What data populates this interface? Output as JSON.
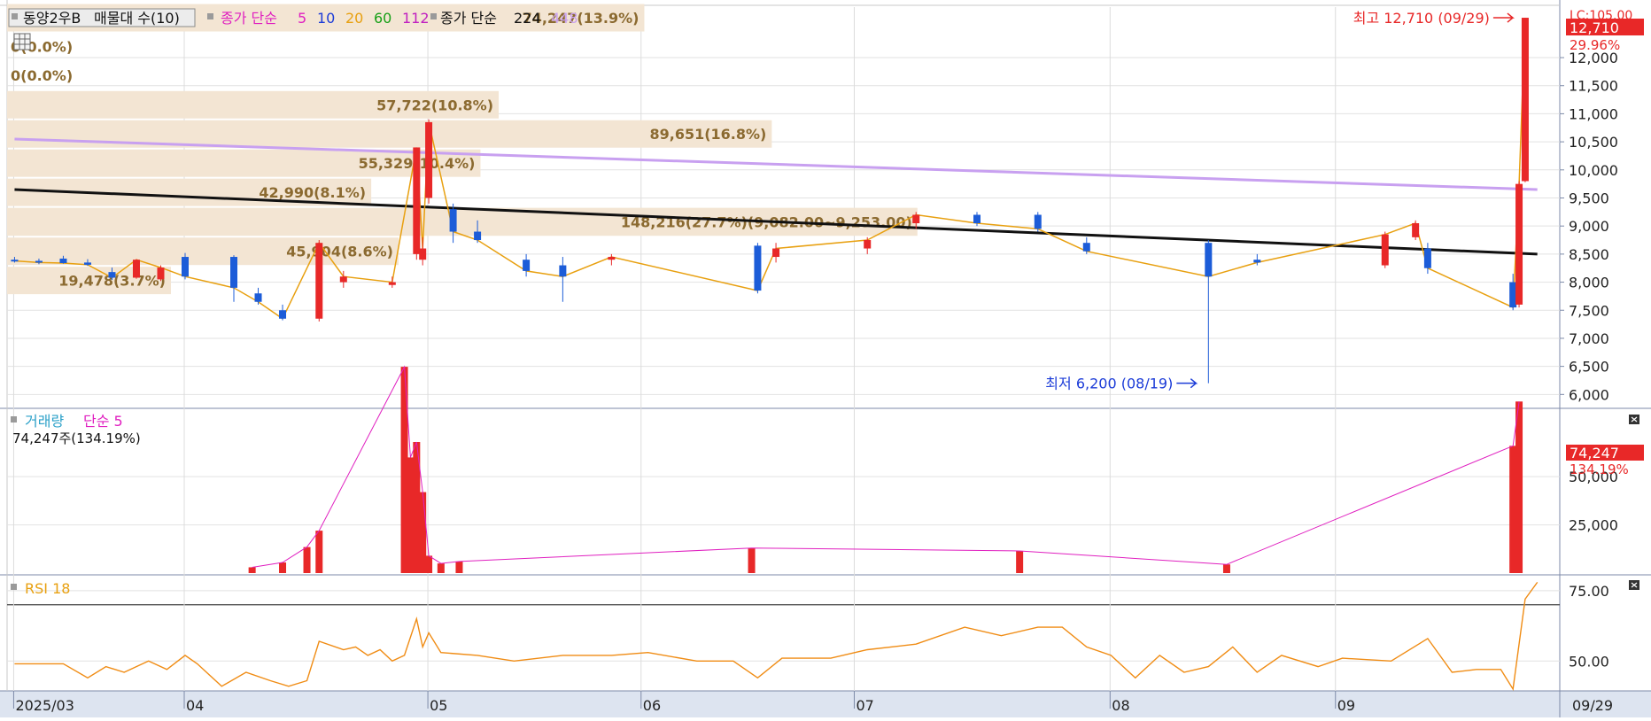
{
  "header": {
    "title": "동양2우B",
    "vp_label": "매물대 수(10)",
    "ma_prefix": "종가 단순",
    "ma_periods": [
      "5",
      "10",
      "20",
      "60",
      "112"
    ],
    "ma_colors": [
      "#e020c0",
      "#1c3cd8",
      "#e8a010",
      "#18a018",
      "#c020c0"
    ],
    "ma2_prefix": "종가 단순",
    "ma2_periods": [
      "224",
      "448"
    ],
    "ma2_colors": [
      "#111111",
      "#c8a0f0"
    ]
  },
  "price_panel": {
    "ylim": [
      5800,
      12900
    ],
    "ticks": [
      "12,000",
      "11,500",
      "11,000",
      "10,500",
      "10,000",
      "9,500",
      "9,000",
      "8,500",
      "8,000",
      "7,500",
      "7,000",
      "6,500",
      "6,000"
    ],
    "tick_values": [
      12000,
      11500,
      11000,
      10500,
      10000,
      9500,
      9000,
      8500,
      8000,
      7500,
      7000,
      6500,
      6000
    ],
    "last_price_label": "12,710",
    "last_change_label": "29.96%",
    "corner_label": "LC:105.00",
    "high_label": "최고 12,710 (09/29)",
    "low_label": "최저 6,200 (08/19)",
    "volume_profile": [
      {
        "label": "74,247(13.9%)",
        "low": 12450,
        "high": 12970,
        "width": 0.7
      },
      {
        "label": "0(0.0%)",
        "low": 11950,
        "high": 12450,
        "width": 0.0
      },
      {
        "label": "0(0.0%)",
        "low": 11420,
        "high": 11950,
        "width": 0.0
      },
      {
        "label": "57,722(10.8%)",
        "low": 10900,
        "high": 11420,
        "width": 0.54
      },
      {
        "label": "89,651(16.8%)",
        "low": 10380,
        "high": 10900,
        "width": 0.84
      },
      {
        "label": "55,329(10.4%)",
        "low": 9860,
        "high": 10380,
        "width": 0.52
      },
      {
        "label": "42,990(8.1%)",
        "low": 9340,
        "high": 9860,
        "width": 0.4
      },
      {
        "label": "148,216(27.7%)(9,082.00~9,253.00)",
        "low": 8810,
        "high": 9340,
        "width": 1.4
      },
      {
        "label": "45,904(8.6%)",
        "low": 8290,
        "high": 8810,
        "width": 0.43
      },
      {
        "label": "19,478(3.7%)",
        "low": 7770,
        "high": 8290,
        "width": 0.18
      }
    ]
  },
  "volume_panel": {
    "title": "거래량",
    "ma_label": "단순 5",
    "current_label": "74,247주(134.19%)",
    "ylim": [
      0,
      85000
    ],
    "ticks": [
      "50,000",
      "25,000"
    ],
    "tick_values": [
      50000,
      25000
    ],
    "last_volume_label": "74,247",
    "last_ratio_label": "134.19%"
  },
  "rsi_panel": {
    "title": "RSI 18",
    "ylim": [
      40,
      80
    ],
    "ticks": [
      "75.00",
      "50.00"
    ],
    "tick_values": [
      75,
      50
    ],
    "threshold": 70
  },
  "x_axis": {
    "labels": [
      "2025/03",
      "04",
      "05",
      "06",
      "07",
      "08",
      "09",
      "09/29"
    ],
    "label_index": [
      0,
      28,
      68,
      103,
      138,
      180,
      217,
      260
    ]
  },
  "chart_data": {
    "type": "candlestick",
    "title": "동양2우B",
    "n_days": 252,
    "price_high": {
      "value": 12710,
      "date": "09/29"
    },
    "price_low": {
      "value": 6200,
      "date": "08/19"
    },
    "ohlc": [
      {
        "i": 0,
        "o": 8400,
        "h": 8450,
        "l": 8350,
        "c": 8380
      },
      {
        "i": 4,
        "o": 8380,
        "h": 8420,
        "l": 8320,
        "c": 8350
      },
      {
        "i": 8,
        "o": 8420,
        "h": 8470,
        "l": 8330,
        "c": 8340
      },
      {
        "i": 12,
        "o": 8350,
        "h": 8410,
        "l": 8290,
        "c": 8310
      },
      {
        "i": 16,
        "o": 8180,
        "h": 8260,
        "l": 8040,
        "c": 8080
      },
      {
        "i": 20,
        "o": 8080,
        "h": 8410,
        "l": 8060,
        "c": 8400
      },
      {
        "i": 24,
        "o": 8050,
        "h": 8300,
        "l": 8020,
        "c": 8260
      },
      {
        "i": 28,
        "o": 8450,
        "h": 8520,
        "l": 8050,
        "c": 8100
      },
      {
        "i": 36,
        "o": 8450,
        "h": 8480,
        "l": 7650,
        "c": 7900
      },
      {
        "i": 40,
        "o": 7800,
        "h": 7900,
        "l": 7600,
        "c": 7650
      },
      {
        "i": 44,
        "o": 7500,
        "h": 7600,
        "l": 7320,
        "c": 7350
      },
      {
        "i": 50,
        "o": 7350,
        "h": 8750,
        "l": 7300,
        "c": 8700
      },
      {
        "i": 54,
        "o": 8000,
        "h": 8200,
        "l": 7900,
        "c": 8100
      },
      {
        "i": 62,
        "o": 7950,
        "h": 8100,
        "l": 7900,
        "c": 8000
      },
      {
        "i": 66,
        "o": 8500,
        "h": 10400,
        "l": 8400,
        "c": 10400
      },
      {
        "i": 67,
        "o": 8400,
        "h": 8800,
        "l": 8300,
        "c": 8600
      },
      {
        "i": 68,
        "o": 9500,
        "h": 10900,
        "l": 9400,
        "c": 10850
      },
      {
        "i": 72,
        "o": 9300,
        "h": 9400,
        "l": 8700,
        "c": 8900
      },
      {
        "i": 76,
        "o": 8900,
        "h": 9100,
        "l": 8700,
        "c": 8750
      },
      {
        "i": 84,
        "o": 8400,
        "h": 8500,
        "l": 8100,
        "c": 8200
      },
      {
        "i": 90,
        "o": 8300,
        "h": 8450,
        "l": 7650,
        "c": 8100
      },
      {
        "i": 98,
        "o": 8400,
        "h": 8500,
        "l": 8300,
        "c": 8450
      },
      {
        "i": 122,
        "o": 8650,
        "h": 8700,
        "l": 7800,
        "c": 7850
      },
      {
        "i": 125,
        "o": 8450,
        "h": 8700,
        "l": 8350,
        "c": 8600
      },
      {
        "i": 140,
        "o": 8600,
        "h": 8800,
        "l": 8500,
        "c": 8750
      },
      {
        "i": 148,
        "o": 9050,
        "h": 9250,
        "l": 8950,
        "c": 9200
      },
      {
        "i": 158,
        "o": 9200,
        "h": 9250,
        "l": 9000,
        "c": 9050
      },
      {
        "i": 168,
        "o": 9200,
        "h": 9250,
        "l": 8900,
        "c": 8950
      },
      {
        "i": 176,
        "o": 8700,
        "h": 8800,
        "l": 8500,
        "c": 8550
      },
      {
        "i": 196,
        "o": 8700,
        "h": 8750,
        "l": 6200,
        "c": 8100
      },
      {
        "i": 204,
        "o": 8400,
        "h": 8500,
        "l": 8300,
        "c": 8350
      },
      {
        "i": 225,
        "o": 8300,
        "h": 8900,
        "l": 8250,
        "c": 8850
      },
      {
        "i": 230,
        "o": 8800,
        "h": 9100,
        "l": 8750,
        "c": 9050
      },
      {
        "i": 232,
        "o": 8600,
        "h": 8700,
        "l": 8150,
        "c": 8250
      },
      {
        "i": 246,
        "o": 8000,
        "h": 8150,
        "l": 7500,
        "c": 7550
      },
      {
        "i": 247,
        "o": 7600,
        "h": 9800,
        "l": 7550,
        "c": 9750
      },
      {
        "i": 248,
        "o": 9800,
        "h": 12710,
        "l": 9780,
        "c": 12710
      }
    ],
    "ma_224": {
      "start": 9650,
      "end": 8500
    },
    "ma_448": {
      "start": 10550,
      "end": 9650
    },
    "volume": [
      {
        "i": 39,
        "v": 3000
      },
      {
        "i": 44,
        "v": 5500
      },
      {
        "i": 48,
        "v": 13500
      },
      {
        "i": 50,
        "v": 22000
      },
      {
        "i": 64,
        "v": 107000
      },
      {
        "i": 65,
        "v": 60000
      },
      {
        "i": 66,
        "v": 68000
      },
      {
        "i": 67,
        "v": 42000
      },
      {
        "i": 68,
        "v": 9000
      },
      {
        "i": 70,
        "v": 5000
      },
      {
        "i": 73,
        "v": 6000
      },
      {
        "i": 121,
        "v": 13000
      },
      {
        "i": 165,
        "v": 11500
      },
      {
        "i": 199,
        "v": 4500
      },
      {
        "i": 246,
        "v": 66000
      },
      {
        "i": 247,
        "v": 89000
      }
    ],
    "rsi": [
      [
        0,
        49
      ],
      [
        8,
        49
      ],
      [
        12,
        44
      ],
      [
        15,
        48
      ],
      [
        18,
        46
      ],
      [
        22,
        50
      ],
      [
        25,
        47
      ],
      [
        28,
        52
      ],
      [
        30,
        49
      ],
      [
        34,
        41
      ],
      [
        38,
        46
      ],
      [
        42,
        43
      ],
      [
        45,
        41
      ],
      [
        48,
        43
      ],
      [
        50,
        57
      ],
      [
        54,
        54
      ],
      [
        56,
        55
      ],
      [
        58,
        52
      ],
      [
        60,
        54
      ],
      [
        62,
        50
      ],
      [
        64,
        52
      ],
      [
        66,
        65
      ],
      [
        67,
        55
      ],
      [
        68,
        60
      ],
      [
        70,
        53
      ],
      [
        76,
        52
      ],
      [
        82,
        50
      ],
      [
        90,
        52
      ],
      [
        98,
        52
      ],
      [
        104,
        53
      ],
      [
        112,
        50
      ],
      [
        118,
        50
      ],
      [
        122,
        44
      ],
      [
        126,
        51
      ],
      [
        134,
        51
      ],
      [
        140,
        54
      ],
      [
        148,
        56
      ],
      [
        156,
        62
      ],
      [
        162,
        59
      ],
      [
        168,
        62
      ],
      [
        172,
        62
      ],
      [
        176,
        55
      ],
      [
        180,
        52
      ],
      [
        184,
        44
      ],
      [
        188,
        52
      ],
      [
        192,
        46
      ],
      [
        196,
        48
      ],
      [
        200,
        55
      ],
      [
        204,
        46
      ],
      [
        208,
        52
      ],
      [
        214,
        48
      ],
      [
        218,
        51
      ],
      [
        226,
        50
      ],
      [
        232,
        58
      ],
      [
        236,
        46
      ],
      [
        240,
        47
      ],
      [
        244,
        47
      ],
      [
        246,
        40
      ],
      [
        248,
        72
      ],
      [
        250,
        78
      ]
    ]
  }
}
